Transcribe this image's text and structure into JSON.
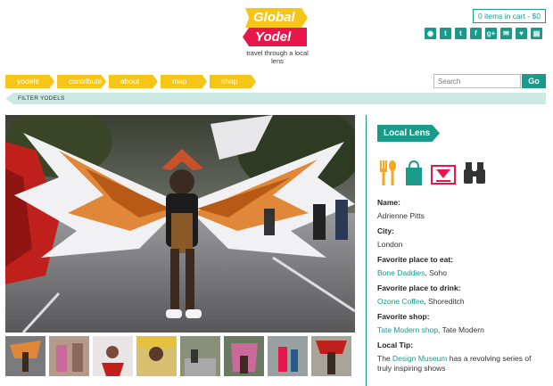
{
  "logo": {
    "line1": "Global",
    "line2": "Yodel",
    "tagline": "travel through a local lens"
  },
  "cart": {
    "label": "0 items in cart - $0"
  },
  "social": [
    {
      "icon": "instagram-icon",
      "glyph": "◉"
    },
    {
      "icon": "twitter-icon",
      "glyph": "t"
    },
    {
      "icon": "tumblr-icon",
      "glyph": "t"
    },
    {
      "icon": "facebook-icon",
      "glyph": "f"
    },
    {
      "icon": "google-plus-icon",
      "glyph": "g+"
    },
    {
      "icon": "email-icon",
      "glyph": "✉"
    },
    {
      "icon": "like-icon",
      "glyph": "👍"
    },
    {
      "icon": "book-icon",
      "glyph": "▤"
    }
  ],
  "nav": {
    "items": [
      "yodels",
      "contribute",
      "about",
      "map",
      "shop"
    ]
  },
  "search": {
    "placeholder": "Search",
    "go_label": "Go"
  },
  "filter": {
    "label": "FILTER YODELS"
  },
  "sidebar": {
    "badge": "Local Lens",
    "icons": [
      "fork-spoon-icon",
      "shopping-bag-icon",
      "cocktail-icon",
      "binoculars-icon"
    ],
    "name_label": "Name:",
    "name_value": "Adrienne Pitts",
    "city_label": "City:",
    "city_value": "London",
    "eat_label": "Favorite place to eat:",
    "eat_link": "Bone Daddies",
    "eat_rest": ", Soho",
    "drink_label": "Favorite place to drink:",
    "drink_link": "Ozone Coffee",
    "drink_rest": ", Shoreditch",
    "shop_label": "Favorite shop:",
    "shop_link": "Tate Modern shop",
    "shop_rest": ", Tate Modern",
    "tip_label": "Local Tip:",
    "tip_pre": "The ",
    "tip_link": "Design Museum",
    "tip_rest": " has a revolving series of truly inspiring shows"
  },
  "thumbnails_count": 8
}
